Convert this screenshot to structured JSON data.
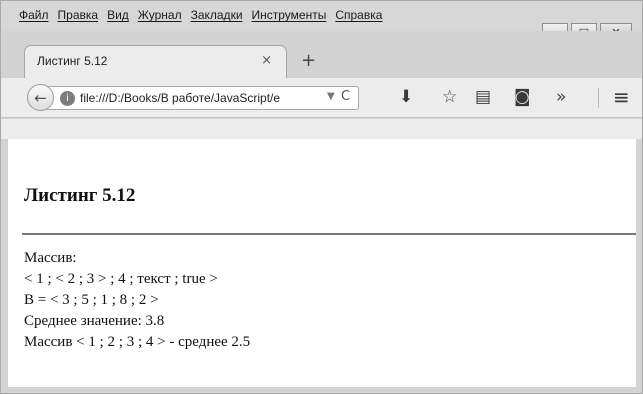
{
  "menubar": {
    "items": [
      {
        "label": "Файл"
      },
      {
        "label": "Правка"
      },
      {
        "label": "Вид"
      },
      {
        "label": "Журнал"
      },
      {
        "label": "Закладки"
      },
      {
        "label": "Инструменты"
      },
      {
        "label": "Справка"
      }
    ],
    "window_controls": {
      "minimize_glyph": "—",
      "maximize_glyph": "□",
      "close_glyph": "✕"
    }
  },
  "tabs": {
    "active_title": "Листинг 5.12",
    "close_glyph": "×",
    "new_tab_glyph": "+"
  },
  "navbar": {
    "back_glyph": "←",
    "site_icon_glyph": "i",
    "url": "file:///D:/Books/В работе/JavaScript/e",
    "dropdown_glyph": "▼",
    "reload_glyph": "C",
    "icons": [
      "download-icon",
      "bookmark-star-icon",
      "reader-view-icon",
      "pocket-icon",
      "overflow-chevron-icon",
      "hamburger-menu-icon"
    ],
    "download_glyph": "⬇",
    "star_glyph": "☆",
    "reader_glyph": "▤",
    "pocket_glyph": "◙",
    "overflow_glyph": "»",
    "menu_glyph": "≡"
  },
  "page": {
    "heading": "Листинг 5.12",
    "lines": [
      "Массив:",
      "< 1 ; < 2 ; 3 > ; 4 ; текст ; true >",
      "B = < 3 ; 5 ; 1 ; 8 ; 2 >",
      "Среднее значение: 3.8",
      "Массив < 1 ; 2 ; 3 ; 4 > - среднее 2.5"
    ]
  },
  "colors": {
    "chrome_background": "#d3d3d3",
    "toolbar_background": "#ececec",
    "page_background": "#ffffff"
  }
}
